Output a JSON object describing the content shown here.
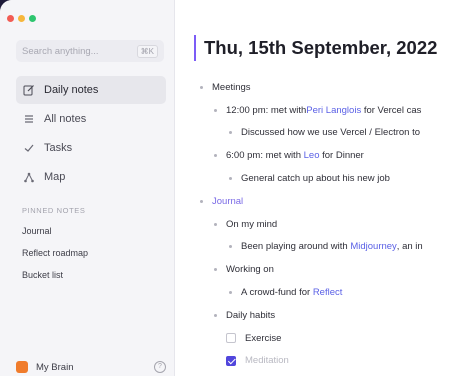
{
  "window": {
    "traffic_lights": [
      "#f25c54",
      "#f6b73c",
      "#2ec56f"
    ]
  },
  "sidebar": {
    "search": {
      "placeholder": "Search anything...",
      "shortcut": "⌘K"
    },
    "nav": [
      {
        "label": "Daily notes",
        "icon": "edit-icon",
        "active": true
      },
      {
        "label": "All notes",
        "icon": "list-icon",
        "active": false
      },
      {
        "label": "Tasks",
        "icon": "check-icon",
        "active": false
      },
      {
        "label": "Map",
        "icon": "graph-icon",
        "active": false
      }
    ],
    "pinned_title": "PINNED NOTES",
    "pinned": [
      "Journal",
      "Reflect roadmap",
      "Bucket list"
    ],
    "brain_label": "My Brain",
    "brain_color": "#f07c2c",
    "help": "?"
  },
  "note": {
    "title": "Thu, 15th September, 2022",
    "accent": "#7c5cf6",
    "meetings": "Meetings",
    "m1_pre": "12:00 pm: met with ",
    "m1_link": "Peri Langlois",
    "m1_post": " for Vercel cas",
    "m1_sub": "Discussed how we use Vercel / Electron to",
    "m2_pre": "6:00 pm: met with ",
    "m2_link": "Leo",
    "m2_post": " for Dinner",
    "m2_sub": "General catch up about his new job",
    "journal": "Journal",
    "on_my_mind": "On my mind",
    "mind_pre": "Been playing around with ",
    "mind_link": "Midjourney",
    "mind_post": ", an in",
    "working_on": "Working on",
    "work_pre": "A crowd-fund for ",
    "work_link": "Reflect",
    "daily_habits": "Daily habits",
    "habits": [
      {
        "label": "Exercise",
        "checked": false
      },
      {
        "label": "Meditation",
        "checked": true
      }
    ]
  }
}
